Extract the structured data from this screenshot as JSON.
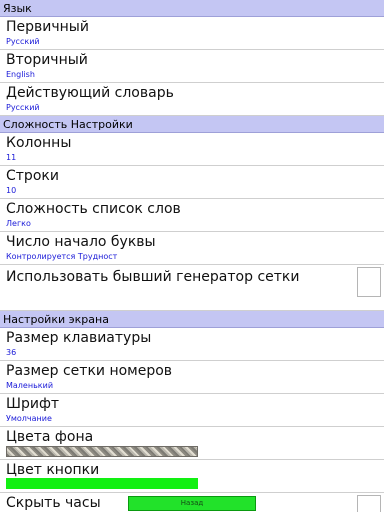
{
  "sections": {
    "language": {
      "header": "Язык",
      "primary": {
        "title": "Первичный",
        "value": "Русский"
      },
      "secondary": {
        "title": "Вторичный",
        "value": "English"
      },
      "dictionary": {
        "title": "Действующий словарь",
        "value": "Русский"
      }
    },
    "difficulty": {
      "header": "Сложность Настройки",
      "columns": {
        "title": "Колонны",
        "value": "11"
      },
      "rows": {
        "title": "Строки",
        "value": "10"
      },
      "word_list": {
        "title": "Сложность список слов",
        "value": "Легко"
      },
      "start_letters": {
        "title": "Число начало буквы",
        "value": "Контролируется Трудност"
      },
      "old_generator": {
        "title": "Использовать бывший генератор сетки",
        "checked": false
      }
    },
    "screen": {
      "header": "Настройки экрана",
      "keyboard_size": {
        "title": "Размер клавиатуры",
        "value": "36"
      },
      "number_grid_size": {
        "title": "Размер сетки номеров",
        "value": "Маленький"
      },
      "font": {
        "title": "Шрифт",
        "value": "Умолчание"
      },
      "bg_color": {
        "title": "Цвета фона"
      },
      "button_color": {
        "title": "Цвет кнопки",
        "color": "#12f012"
      },
      "hide_clock": {
        "title": "Скрыть часы",
        "checked": false
      }
    }
  },
  "footer": {
    "back_label": "Назад"
  }
}
